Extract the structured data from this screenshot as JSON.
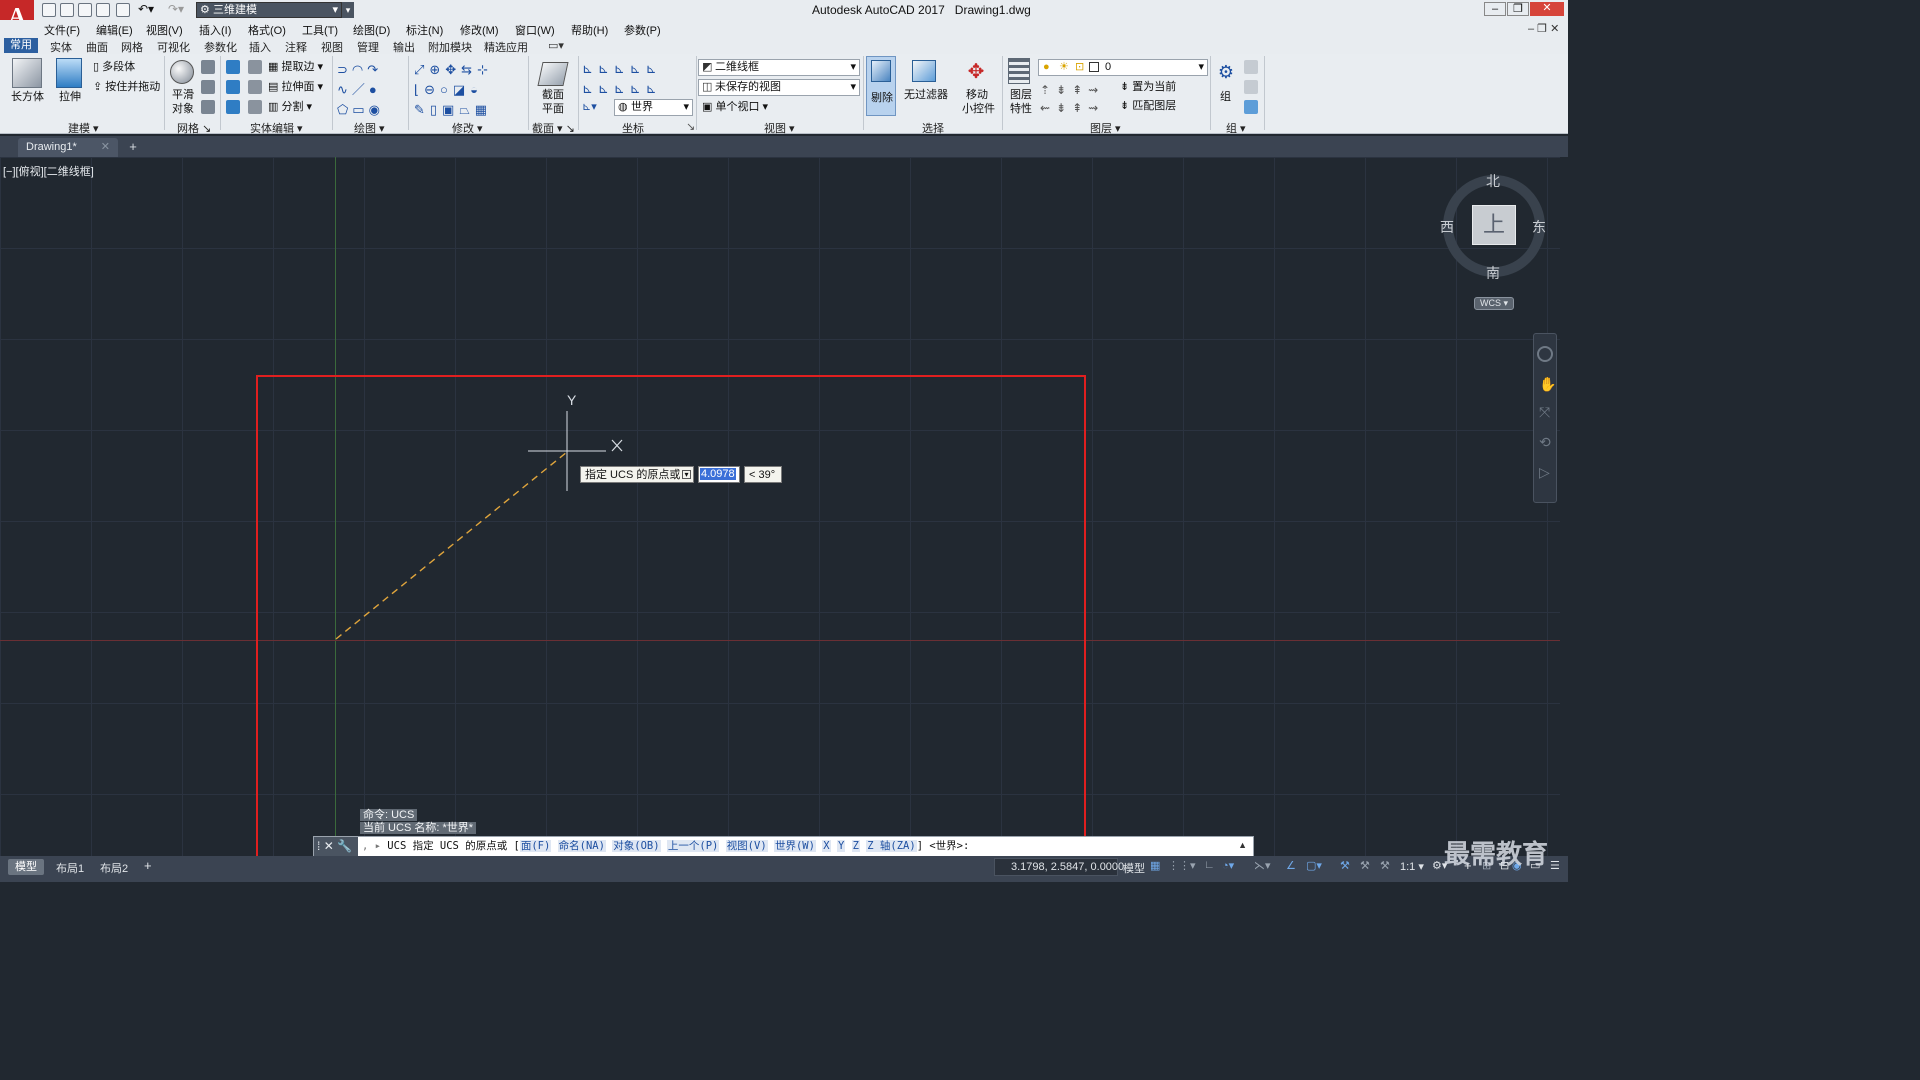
{
  "title_bar": {
    "app_title": "Autodesk AutoCAD 2017",
    "file_name": "Drawing1.dwg",
    "workspace": "三维建模",
    "logo_letter": "A"
  },
  "menus": [
    "文件(F)",
    "编辑(E)",
    "视图(V)",
    "插入(I)",
    "格式(O)",
    "工具(T)",
    "绘图(D)",
    "标注(N)",
    "修改(M)",
    "窗口(W)",
    "帮助(H)",
    "参数(P)"
  ],
  "ribbon_tabs": [
    "常用",
    "实体",
    "曲面",
    "网格",
    "可视化",
    "参数化",
    "插入",
    "注释",
    "视图",
    "管理",
    "输出",
    "附加模块",
    "精选应用"
  ],
  "ribbon": {
    "modeling": {
      "box": "长方体",
      "extrude": "拉伸",
      "polysolid": "多段体",
      "presspull": "按住并拖动",
      "panel": "建模"
    },
    "mesh": {
      "smooth_line1": "平滑",
      "smooth_line2": "对象",
      "panel": "网格"
    },
    "solid_edit": {
      "extract_edges": "提取边",
      "extrude_faces": "拉伸面",
      "separate": "分割",
      "panel": "实体编辑"
    },
    "draw": {
      "panel": "绘图"
    },
    "modify": {
      "panel": "修改"
    },
    "section": {
      "plane_line1": "截面",
      "plane_line2": "平面",
      "panel": "截面"
    },
    "coordinates": {
      "world": "世界",
      "panel": "坐标"
    },
    "view": {
      "visual_style": "二维线框",
      "named_view": "未保存的视图",
      "viewport": "单个视口",
      "panel": "视图"
    },
    "selection": {
      "cull": "剔除",
      "no_filter": "无过滤器",
      "gizmo_line1": "移动",
      "gizmo_line2": "小控件",
      "panel": "选择"
    },
    "layers": {
      "props_line1": "图层",
      "props_line2": "特性",
      "current_layer": "0",
      "set_current": "置为当前",
      "match_layer": "匹配图层",
      "panel": "图层"
    },
    "groups": {
      "group": "组",
      "panel": "组"
    }
  },
  "doc_tabs": [
    {
      "label": "Drawing1*"
    }
  ],
  "viewport": {
    "label": "[−][俯视][二维线框]",
    "compass": {
      "north": "北",
      "south": "南",
      "east": "东",
      "west": "西",
      "top": "上"
    },
    "wcs": "WCS",
    "ucs_y": "Y",
    "dynamic_input": {
      "prompt": "指定 UCS 的原点或",
      "distance": "4.0978",
      "angle": "< 39°"
    }
  },
  "command": {
    "history": [
      "命令: UCS",
      "当前 UCS 名称: *世界*"
    ],
    "prompt_prefix": "UCS 指定 UCS 的原点或 [",
    "options": [
      "面(F)",
      "命名(NA)",
      "对象(OB)",
      "上一个(P)",
      "视图(V)",
      "世界(W)",
      "X",
      "Y",
      "Z",
      "Z 轴(ZA)"
    ],
    "prompt_suffix": "] <世界>:"
  },
  "status": {
    "layout_tabs": [
      "模型",
      "布局1",
      "布局2"
    ],
    "coords": "3.1798, 2.5847, 0.0000",
    "space": "模型",
    "scale": "1:1"
  },
  "watermark": "最需教育",
  "colors": {
    "frame_red": "#e01f1f",
    "dash_yellow": "#e0a53c",
    "crosshair": "#d8dde3",
    "accent_blue": "#2c5fa0"
  }
}
